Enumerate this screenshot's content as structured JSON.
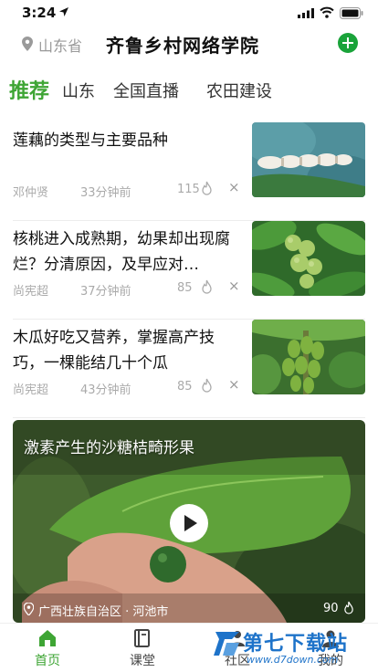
{
  "status_bar": {
    "time": "3:24"
  },
  "header": {
    "province": "山东省",
    "title": "齐鲁乡村网络学院"
  },
  "tabs": [
    {
      "label": "推荐",
      "active": true
    },
    {
      "label": "山东",
      "active": false
    },
    {
      "label": "全国直播",
      "active": false
    },
    {
      "label": "农田建设",
      "active": false
    }
  ],
  "articles": [
    {
      "title": "莲藕的类型与主要品种",
      "author": "邓仲贤",
      "time": "33分钟前",
      "count": "115",
      "close": "×",
      "thumb": "lotus-root-image"
    },
    {
      "title": "核桃进入成熟期，幼果却出现腐烂？分清原因，及早应对…",
      "author": "尚宪超",
      "time": "37分钟前",
      "count": "85",
      "close": "×",
      "thumb": "walnut-image"
    },
    {
      "title": "木瓜好吃又营养，掌握高产技巧，一棵能结几十个瓜",
      "author": "尚宪超",
      "time": "43分钟前",
      "count": "85",
      "close": "×",
      "thumb": "papaya-image"
    }
  ],
  "video": {
    "title": "激素产生的沙糖桔畸形果",
    "location": "广西壮族自治区 · 河池市",
    "count": "90"
  },
  "bottom_nav": [
    {
      "label": "首页",
      "icon": "home-icon",
      "active": true
    },
    {
      "label": "课堂",
      "icon": "book-icon",
      "active": false
    },
    {
      "label": "社区",
      "icon": "community-icon",
      "active": false
    },
    {
      "label": "我的",
      "icon": "profile-icon",
      "active": false
    }
  ],
  "watermark": {
    "text": "第七下载站",
    "url": "www.d7down.com"
  },
  "colors": {
    "accent": "#3ea534",
    "add_button": "#1aa33a",
    "watermark": "#1e73c9"
  }
}
